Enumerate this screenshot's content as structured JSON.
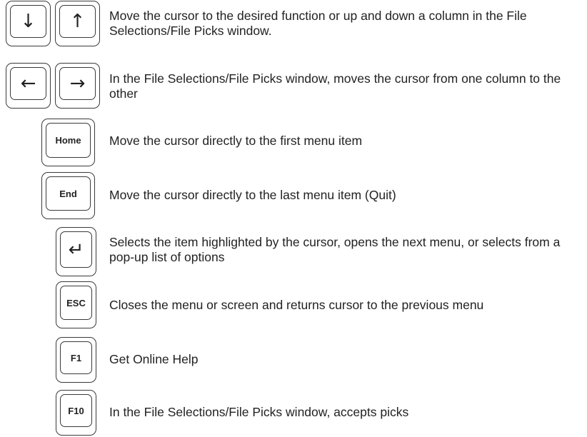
{
  "rows": [
    {
      "keys": [
        {
          "icon": "arrow-down-icon",
          "symbol": "↓"
        },
        {
          "icon": "arrow-up-icon",
          "symbol": "↑"
        }
      ],
      "text": "Move the cursor to the desired function or up and down a column in the File Selections/File Picks window."
    },
    {
      "keys": [
        {
          "icon": "arrow-left-icon",
          "symbol": "←"
        },
        {
          "icon": "arrow-right-icon",
          "symbol": "→"
        }
      ],
      "text": "In the File Selections/File Picks window, moves the cursor from one column to the other"
    },
    {
      "keys": [
        {
          "label": "Home"
        }
      ],
      "text": "Move the cursor directly to the first menu item"
    },
    {
      "keys": [
        {
          "label": "End"
        }
      ],
      "text": "Move the cursor directly to the last menu item (Quit)"
    },
    {
      "keys": [
        {
          "icon": "enter-icon",
          "symbol": "↵"
        }
      ],
      "text": "Selects the item highlighted by the cursor, opens the next menu, or selects from a pop-up list of options"
    },
    {
      "keys": [
        {
          "label": "ESC"
        }
      ],
      "text": "Closes the menu or screen and returns cursor to the previous menu"
    },
    {
      "keys": [
        {
          "label": "F1"
        }
      ],
      "text": "Get Online Help"
    },
    {
      "keys": [
        {
          "label": "F10"
        }
      ],
      "text": "In the File Selections/File Picks window, accepts picks"
    }
  ]
}
